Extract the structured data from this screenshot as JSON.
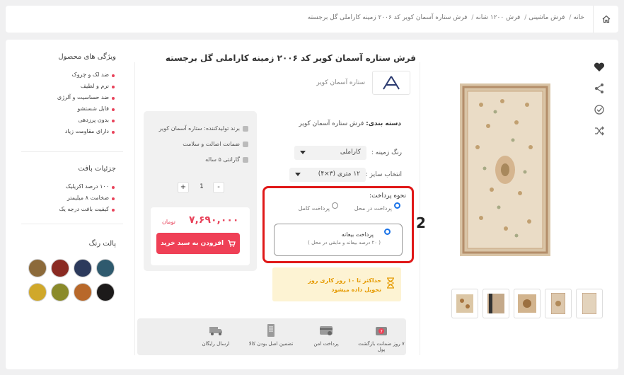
{
  "breadcrumb": {
    "home": "خانه",
    "items": [
      "خانه",
      "فرش ماشینی",
      "فرش ۱۲۰۰ شانه",
      "فرش ستاره آسمان کویر کد ۲۰۰۶ زمینه کاراملی گل برجسته"
    ]
  },
  "product": {
    "title": "فرش ستاره آسمان کویر کد ۲۰۰۶ زمینه کاراملی گل برجسته",
    "brand_name": "ستاره آسمان کویر",
    "category_label": "دسته بندی:",
    "category_value": "فرش ستاره آسمان کویر",
    "bg_color_label": "رنگ زمینه :",
    "bg_color_value": "کاراملی",
    "size_label": "انتخاب سایز :",
    "size_value": "۱۲ متری (۳×۴)"
  },
  "payment": {
    "title": "نحوه پرداخت:",
    "on_site": "پرداخت در محل",
    "full": "پرداخت کامل",
    "advance": "پرداخت بیعانه",
    "advance_note": "( ۲۰ درصد بیعانه و مابقی در محل )",
    "annotation": "2"
  },
  "delivery": {
    "text": "حداکثر تا ۱۰ روز کاری روز تحویل داده میشود"
  },
  "buy_card": {
    "features": [
      "برند تولیدکننده: ستاره آسمان کویر",
      "ضمانت اصالت و سلامت",
      "گارانتی ۵ ساله"
    ],
    "qty_plus": "+",
    "qty_value": "1",
    "qty_minus": "-",
    "price": "۷,۶۹۰,۰۰۰",
    "currency": "تومان",
    "add_to_cart": "افزودن به سبد خرید"
  },
  "guarantees": [
    "۷ روز ضمانت بازگشت پول",
    "پرداخت امن",
    "تضمین اصل بودن کالا",
    "ارسال رایگان"
  ],
  "sidebar": {
    "features_title": "ویژگی های محصول",
    "features": [
      "ضد لک و چروک",
      "نرم و لطیف",
      "ضد حساسیت و آلرژی",
      "قابل شستشو",
      "بدون پرزدهی",
      "دارای مقاومت زیاد"
    ],
    "weave_title": "جزئیات بافت",
    "weave": [
      "۱۰۰ درصد اکریلیک",
      "ضخامت ۸ میلیمتر",
      "کیفیت بافت درجه یک"
    ],
    "palette_title": "پالت رنگ",
    "palette_colors": [
      "#2f5a6e",
      "#2c3a5c",
      "#8a2a22",
      "#8c6a3a",
      "#1c1a1a",
      "#b8682a",
      "#8a8a2a",
      "#d0a82a"
    ]
  },
  "colors": {
    "accent": "#ef4056",
    "warning_bg": "#fdf3d3",
    "warning_text": "#e59a00",
    "highlight": "#e01818"
  }
}
